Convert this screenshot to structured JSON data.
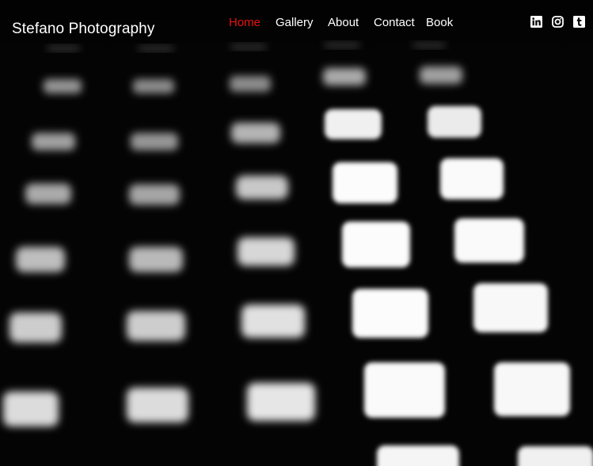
{
  "header": {
    "site_title": "Stefano Photography"
  },
  "nav": {
    "items": [
      {
        "label": "Home",
        "active": true
      },
      {
        "label": "Gallery",
        "active": false
      },
      {
        "label": "About",
        "active": false
      },
      {
        "label": "Contact",
        "active": false
      },
      {
        "label": "Book",
        "active": false
      }
    ],
    "active_color": "#e8120c",
    "link_color": "#ffffff"
  },
  "social": {
    "icons": [
      "linkedin-icon",
      "instagram-icon",
      "tumblr-icon"
    ]
  },
  "hero": {
    "background_color": "#050505"
  }
}
